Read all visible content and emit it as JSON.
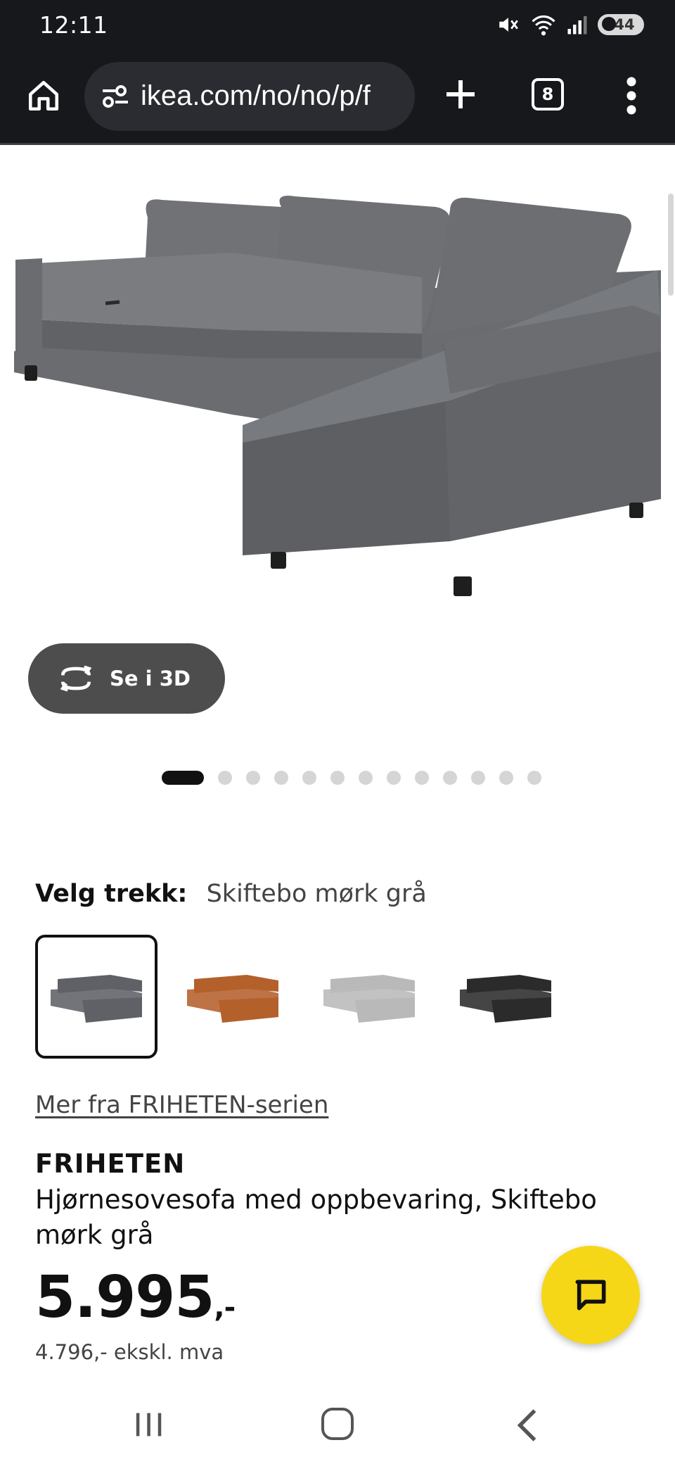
{
  "status_bar": {
    "time": "12:11",
    "battery": "44",
    "icons": [
      "mute-icon",
      "wifi-icon",
      "signal-icon",
      "battery-icon"
    ]
  },
  "browser": {
    "url": "ikea.com/no/no/p/f",
    "tab_count": "8",
    "icons": [
      "home-icon",
      "site-settings-icon",
      "plus-icon",
      "tabs-icon",
      "more-vert-icon"
    ]
  },
  "product": {
    "view_3d_label": "Se i 3D",
    "carousel": {
      "total": 13,
      "active_index": 0
    },
    "cover_label": "Velg trekk:",
    "cover_value": "Skiftebo mørk grå",
    "swatches": [
      {
        "name": "dark-grey",
        "color": "#5f6166",
        "selected": true
      },
      {
        "name": "orange",
        "color": "#b4602b",
        "selected": false
      },
      {
        "name": "light-grey",
        "color": "#b8b9b8",
        "selected": false
      },
      {
        "name": "black",
        "color": "#2b2b2b",
        "selected": false
      }
    ],
    "series_link": "Mer fra FRIHETEN-serien",
    "brand": "FRIHETEN",
    "description": "Hjørnesovesofa med oppbevaring, Skiftebo mørk grå",
    "price_main": "5.995",
    "price_suffix": ",-",
    "price_ex_vat": "4.796,- ekskl. mva"
  },
  "colors": {
    "brand_yellow": "#f5d718",
    "browser_dark": "#17181c",
    "sofa_grey": "#6b6d70"
  }
}
